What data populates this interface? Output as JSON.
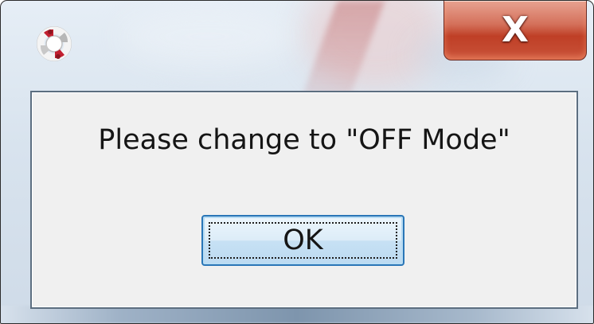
{
  "window": {
    "title": "",
    "icon": "lifebuoy-icon",
    "close_glyph": "X",
    "accent_color": "#c84a30"
  },
  "dialog": {
    "message": "Please change to \"OFF Mode\"",
    "ok_label": "OK"
  }
}
